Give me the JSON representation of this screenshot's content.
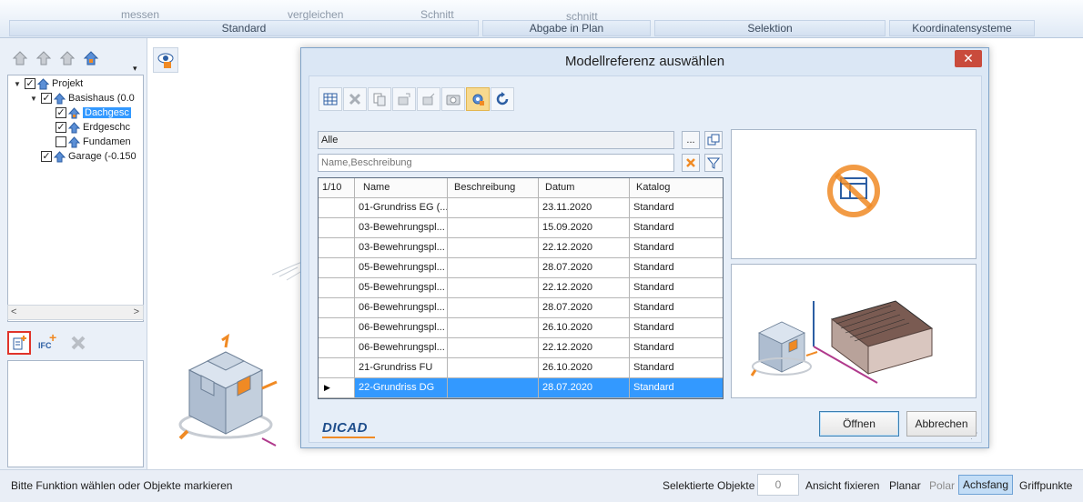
{
  "ribbon": {
    "faded_row": [
      "messen",
      "vergleichen",
      "Schnitt",
      "schnitt"
    ],
    "groups": [
      "Standard",
      "Abgabe in Plan",
      "Selektion",
      "Koordinatensysteme"
    ]
  },
  "tree": {
    "items": [
      {
        "label": "Projekt",
        "checked": true
      },
      {
        "label": "Basishaus (0.0",
        "checked": true
      },
      {
        "label": "Dachgesc",
        "checked": true,
        "selected": true
      },
      {
        "label": "Erdgeschc",
        "checked": true
      },
      {
        "label": "Fundamen",
        "checked": false
      },
      {
        "label": "Garage (-0.150",
        "checked": true
      }
    ]
  },
  "left_tools": {
    "ifc_label": "IFC"
  },
  "dialog": {
    "title": "Modellreferenz auswählen",
    "close_glyph": "✕",
    "filter_value": "Alle",
    "filter_btn": "...",
    "search_placeholder": "Name,Beschreibung",
    "grid": {
      "headers": [
        "1/10",
        "Name",
        "Beschreibung",
        "Datum",
        "Katalog"
      ],
      "rows": [
        {
          "marker": "",
          "name": "01-Grundriss EG (...",
          "desc": "",
          "date": "23.11.2020",
          "catalog": "Standard"
        },
        {
          "marker": "",
          "name": "03-Bewehrungspl...",
          "desc": "",
          "date": "15.09.2020",
          "catalog": "Standard"
        },
        {
          "marker": "",
          "name": "03-Bewehrungspl...",
          "desc": "",
          "date": "22.12.2020",
          "catalog": "Standard"
        },
        {
          "marker": "",
          "name": "05-Bewehrungspl...",
          "desc": "",
          "date": "28.07.2020",
          "catalog": "Standard"
        },
        {
          "marker": "",
          "name": "05-Bewehrungspl...",
          "desc": "",
          "date": "22.12.2020",
          "catalog": "Standard"
        },
        {
          "marker": "",
          "name": "06-Bewehrungspl...",
          "desc": "",
          "date": "28.07.2020",
          "catalog": "Standard"
        },
        {
          "marker": "",
          "name": "06-Bewehrungspl...",
          "desc": "",
          "date": "26.10.2020",
          "catalog": "Standard"
        },
        {
          "marker": "",
          "name": "06-Bewehrungspl...",
          "desc": "",
          "date": "22.12.2020",
          "catalog": "Standard"
        },
        {
          "marker": "",
          "name": "21-Grundriss FU",
          "desc": "",
          "date": "26.10.2020",
          "catalog": "Standard"
        },
        {
          "marker": "▶",
          "name": "22-Grundriss DG",
          "desc": "",
          "date": "28.07.2020",
          "catalog": "Standard",
          "selected": true
        }
      ]
    },
    "logo": "DICAD",
    "open_button": "Öffnen",
    "cancel_button": "Abbrechen"
  },
  "status": {
    "message": "Bitte Funktion wählen oder Objekte markieren",
    "selected_objects_label": "Selektierte Objekte",
    "selected_objects_value": "0",
    "fix_view": "Ansicht fixieren",
    "planar": "Planar",
    "polar": "Polar",
    "axis_snap": "Achsfang",
    "grip_points": "Griffpunkte"
  },
  "colors": {
    "selection": "#3399ff",
    "accent_orange": "#f08a24",
    "close_red": "#c94b3c"
  }
}
